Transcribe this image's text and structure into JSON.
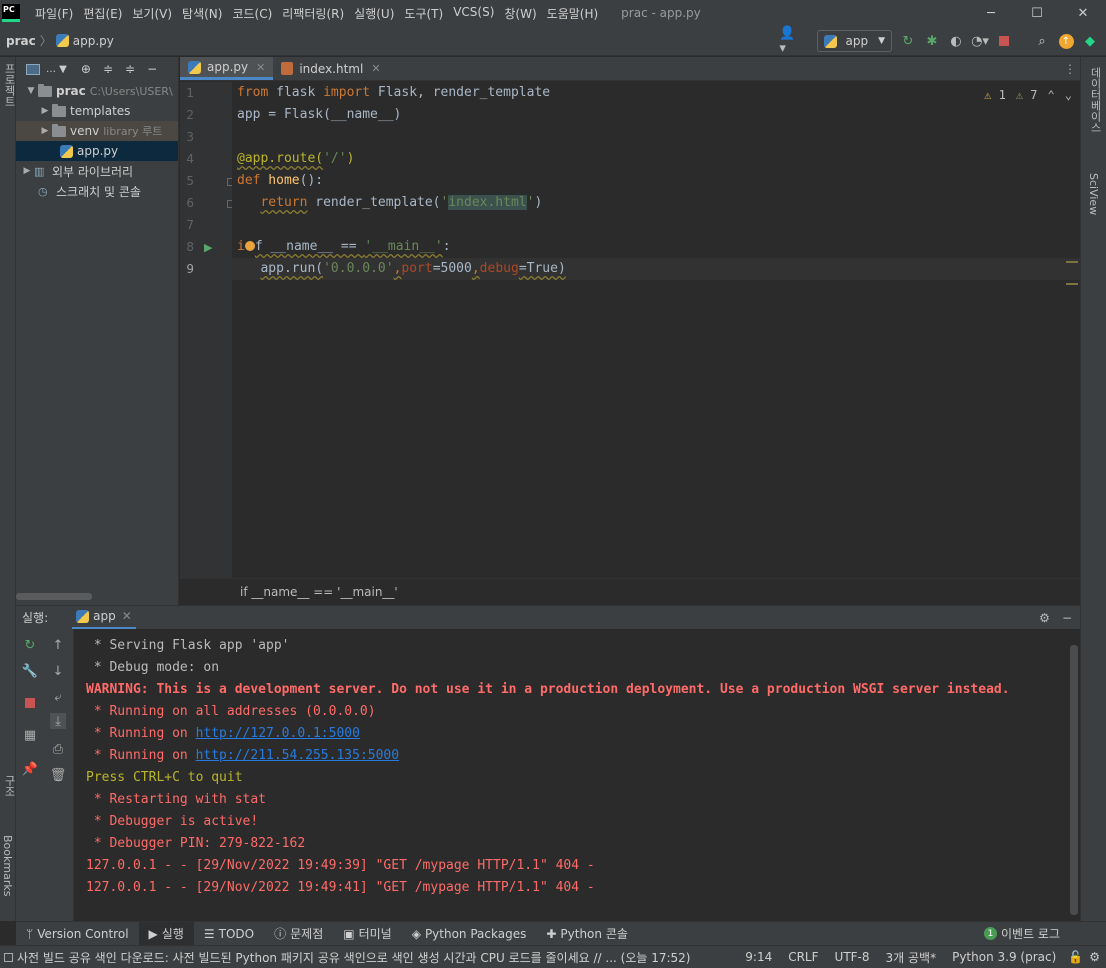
{
  "titlebar": {
    "logo": "PC",
    "menu": [
      "파일(F)",
      "편집(E)",
      "보기(V)",
      "탐색(N)",
      "코드(C)",
      "리팩터링(R)",
      "실행(U)",
      "도구(T)",
      "VCS(S)",
      "창(W)",
      "도움말(H)"
    ],
    "window_title": "prac - app.py"
  },
  "navbar": {
    "project": "prac",
    "file": "app.py",
    "run_config": "app"
  },
  "left_strip": {
    "project_label": "프로젝트",
    "structure_label": "구조",
    "bookmarks_label": "Bookmarks"
  },
  "right_strip": {
    "database_label": "데이터베이스",
    "sciview_label": "SciView"
  },
  "project_tree": {
    "root_name": "prac",
    "root_path": "C:\\Users\\USER\\",
    "items": [
      {
        "label": "templates"
      },
      {
        "label": "venv",
        "extra": "library 루트"
      },
      {
        "label": "app.py"
      },
      {
        "label": "외부 라이브러리"
      },
      {
        "label": "스크래치 및 콘솔"
      }
    ]
  },
  "editor": {
    "tabs": [
      {
        "label": "app.py"
      },
      {
        "label": "index.html"
      }
    ],
    "inspections": {
      "warnings": "1",
      "weak": "7"
    },
    "line_numbers": [
      "1",
      "2",
      "3",
      "4",
      "5",
      "6",
      "7",
      "8",
      "9"
    ],
    "lines": {
      "l1": {
        "k1": "from",
        "t1": " flask ",
        "k2": "import",
        "t2": " Flask, render_template"
      },
      "l2": {
        "t": "app = Flask(__name__)"
      },
      "l4": {
        "dec": "@app.route(",
        "str": "'/'",
        "end": ")"
      },
      "l5": {
        "k": "def",
        "fn": " home",
        "t": "():"
      },
      "l6": {
        "k": "return",
        "t": " render_template(",
        "q1": "'",
        "s": "index.html",
        "q2": "'",
        "e": ")"
      },
      "l8": {
        "k": "i",
        "t": "f __name__ == ",
        "s": "'__main__'",
        "e": ":"
      },
      "l9": {
        "t1": "app.run(",
        "s": "'0.0.0.0'",
        "c1": ",",
        "p1": "port",
        "v1": "=5000",
        "c2": ",",
        "p2": "debug",
        "v2": "=True)"
      }
    },
    "breadcrumb": "if __name__ == '__main__'"
  },
  "run": {
    "label": "실행:",
    "tab": "app",
    "console": [
      {
        "cls": "c-norm",
        "text": " * Serving Flask app 'app'"
      },
      {
        "cls": "c-norm",
        "text": " * Debug mode: on"
      },
      {
        "cls": "c-redb",
        "text": "WARNING: This is a development server. Do not use it in a production deployment. Use a production WSGI server instead."
      },
      {
        "cls": "c-red",
        "text": " * Running on all addresses (0.0.0.0)"
      },
      {
        "cls": "c-red",
        "text": " * Running on ",
        "link": "http://127.0.0.1:5000"
      },
      {
        "cls": "c-red",
        "text": " * Running on ",
        "link": "http://211.54.255.135:5000"
      },
      {
        "cls": "c-yel",
        "text": "Press CTRL+C to quit"
      },
      {
        "cls": "c-red",
        "text": " * Restarting with stat"
      },
      {
        "cls": "c-red",
        "text": " * Debugger is active!"
      },
      {
        "cls": "c-red",
        "text": " * Debugger PIN: 279-822-162"
      },
      {
        "cls": "c-red",
        "text": "127.0.0.1 - - [29/Nov/2022 19:49:39] \"GET /mypage HTTP/1.1\" 404 -"
      },
      {
        "cls": "c-red",
        "text": "127.0.0.1 - - [29/Nov/2022 19:49:41] \"GET /mypage HTTP/1.1\" 404 -"
      }
    ]
  },
  "toolwindows": {
    "version_control": "Version Control",
    "run": "실행",
    "todo": "TODO",
    "problems": "문제점",
    "terminal": "터미널",
    "python_packages": "Python Packages",
    "python_console": "Python 콘솔",
    "event_log": "이벤트 로그",
    "event_count": "1"
  },
  "statusbar": {
    "message": "사전 빌드 공유 색인 다운로드: 사전 빌드된 Python 패키지 공유 색인으로 색인 생성 시간과 CPU 로드를 줄이세요 // ... (오늘 17:52)",
    "position": "9:14",
    "line_sep": "CRLF",
    "encoding": "UTF-8",
    "indent": "3개 공백*",
    "interpreter": "Python 3.9 (prac)"
  },
  "colors": {
    "accent": "#4a88c7",
    "error": "#ff6b68",
    "link": "#287bde",
    "keyword": "#cc7832"
  }
}
